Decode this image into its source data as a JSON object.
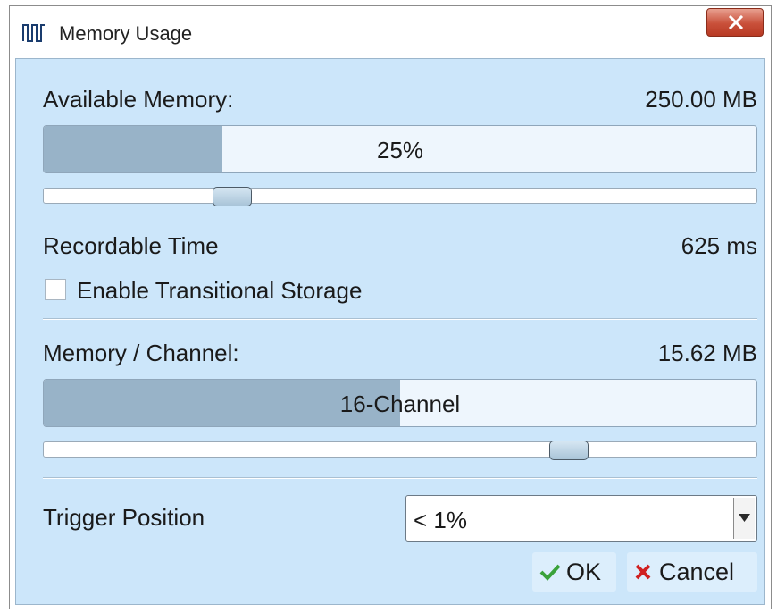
{
  "window": {
    "title": "Memory Usage",
    "app_icon": "waveform-icon",
    "close_icon": "close-icon"
  },
  "memory": {
    "available_label": "Available Memory:",
    "available_value": "250.00 MB",
    "bar_text": "25%",
    "bar_fraction": 0.25,
    "slider_fraction": 0.25
  },
  "recordable": {
    "label": "Recordable Time",
    "value": "625 ms"
  },
  "transitional": {
    "label": "Enable Transitional Storage",
    "checked": false
  },
  "channel": {
    "label": "Memory / Channel:",
    "value": "15.62 MB",
    "bar_text": "16-Channel",
    "bar_fraction": 0.5,
    "slider_fraction": 0.75
  },
  "trigger": {
    "label": "Trigger Position",
    "selected": "< 1%"
  },
  "buttons": {
    "ok": "OK",
    "cancel": "Cancel",
    "ok_icon": "checkmark-icon",
    "cancel_icon": "x-icon"
  },
  "colors": {
    "client_bg": "#cce6fa",
    "bar_fill": "#98b3c8",
    "ok_green": "#3aa23a",
    "cancel_red": "#d02020",
    "close_red": "#c9503a"
  }
}
